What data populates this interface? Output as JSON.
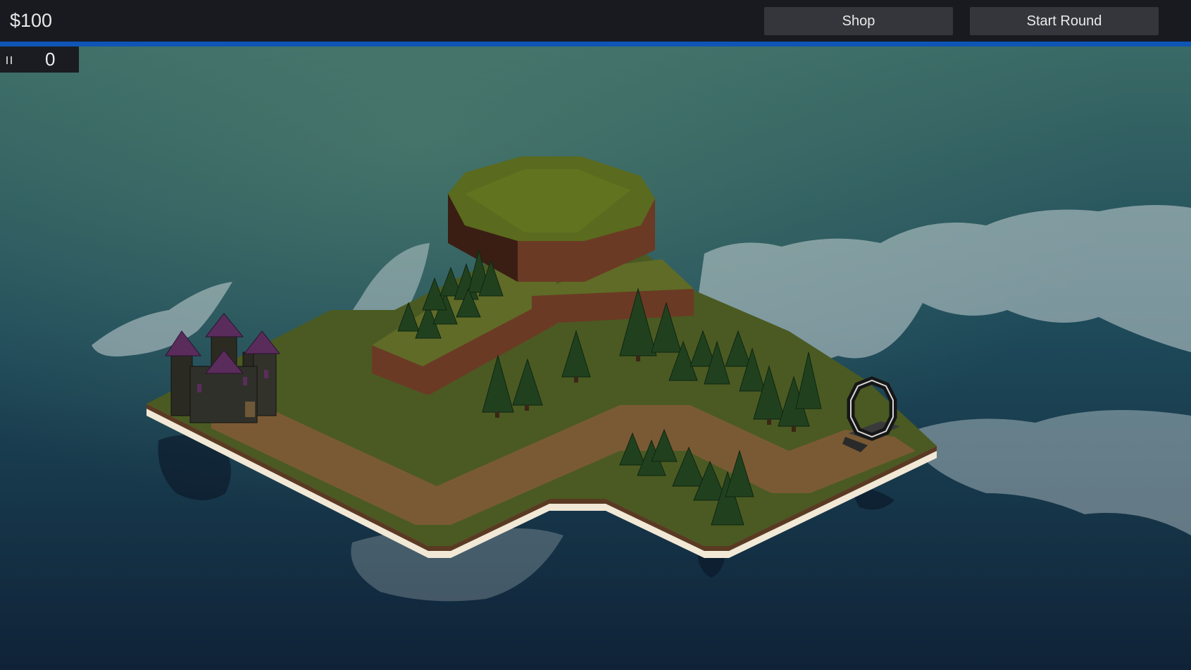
{
  "hud": {
    "money": "$100",
    "shop_label": "Shop",
    "start_round_label": "Start Round",
    "round_counter": "0",
    "pause_icon": "pause-icon"
  },
  "colors": {
    "topbar": "#191a20",
    "accent_bar": "#0f55b5",
    "button": "#34363b",
    "water_top": "#3a6a66",
    "water_bottom": "#0f2238",
    "grass": "#4a5a22",
    "path": "#7a5a34",
    "cliff": "#6b3a24",
    "tree": "#21411e",
    "castle_roof": "#5a2c5c"
  }
}
